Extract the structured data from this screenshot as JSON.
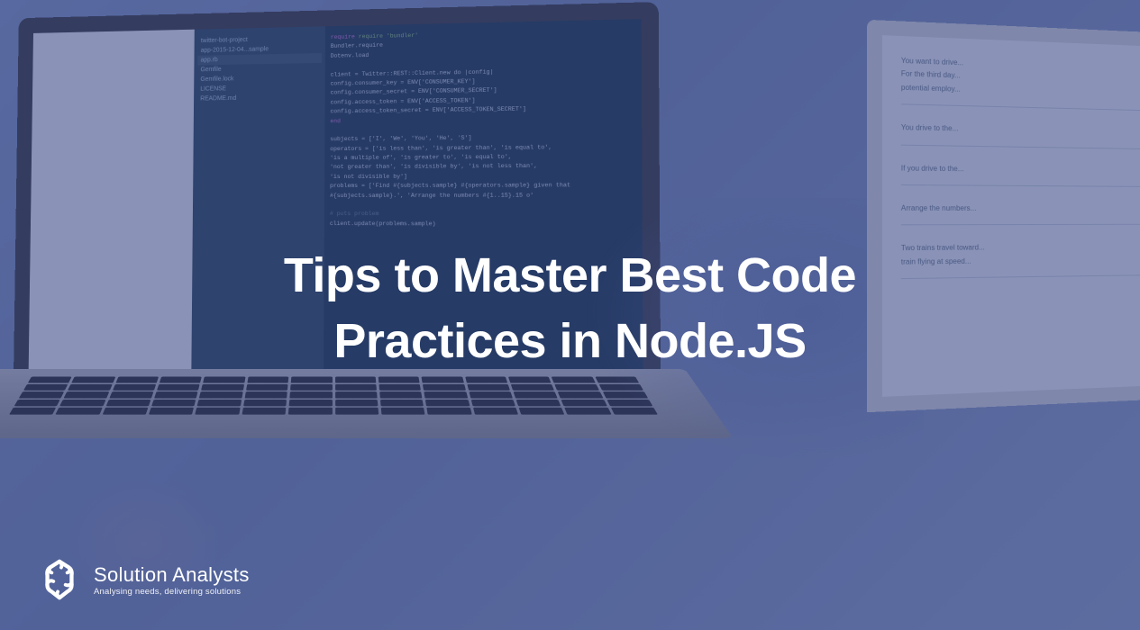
{
  "headline": {
    "line1": "Tips to Master Best Code",
    "line2": "Practices in Node.JS"
  },
  "logo": {
    "company": "Solution Analysts",
    "tagline": "Analysing needs, delivering solutions"
  },
  "code_editor": {
    "sidebar_files": [
      "twitter-bot-project",
      "app-2015-12-04...sample",
      "app.rb",
      "Gemfile",
      "Gemfile.lock",
      "LICENSE",
      "README.md"
    ],
    "code_snippet": [
      "require 'bundler'",
      "Bundler.require",
      "Dotenv.load",
      "",
      "client = Twitter::REST::Client.new do |config|",
      "  config.consumer_key    = ENV['CONSUMER_KEY']",
      "  config.consumer_secret = ENV['CONSUMER_SECRET']",
      "  config.access_token    = ENV['ACCESS_TOKEN']",
      "  config.access_token_secret = ENV['ACCESS_TOKEN_SECRET']",
      "end",
      "",
      "subjects = ['I', 'We', 'You', 'He', 'S']",
      "operators = ['is less than', 'is greater than', 'is equal to',",
      "  'is a multiple of', 'is greater to', 'is equal to',",
      "  'not greater than', 'is divisible by', 'is not less than',",
      "  'is not divisible by']",
      "problems = ['Find #{subjects.sample} #{operators.sample} given that",
      "  #{subjects.sample}.', 'Arrange the numbers #{1..15}.15 o'",
      "",
      "# puts problem",
      "client.update(problems.sample)"
    ]
  },
  "right_screen_text": [
    "You want to drive...",
    "For the third day...",
    "potential employ...",
    "",
    "You drive to the...",
    "",
    "If you drive to the...",
    "",
    "Arrange the numbers...",
    "",
    "Two trains travel toward...",
    "train flying at speed..."
  ]
}
